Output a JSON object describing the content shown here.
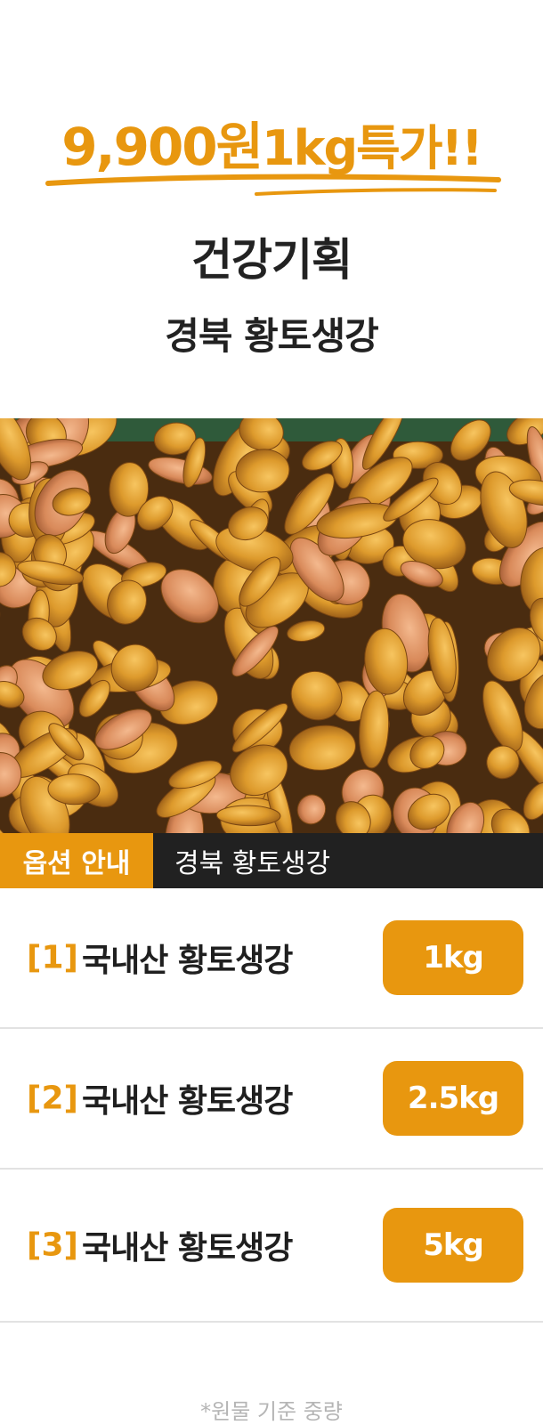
{
  "header": {
    "price": "9,900원",
    "deal": "1kg특가!!",
    "title_line1": "건강기획",
    "title_line2": "경북 황토생강"
  },
  "colors": {
    "accent": "#e8970f",
    "dark_bar": "#212121",
    "divider": "#e2e2e2",
    "footnote": "#b5b5b5"
  },
  "option_bar": {
    "tag": "옵션 안내",
    "product": "경북 황토생강"
  },
  "options": [
    {
      "number": "[1]",
      "name": "국내산 황토생강",
      "weight": "1kg"
    },
    {
      "number": "[2]",
      "name": "국내산 황토생강",
      "weight": "2.5kg"
    },
    {
      "number": "[3]",
      "name": "국내산 황토생강",
      "weight": "5kg"
    }
  ],
  "footnote": "*원물 기준 중량"
}
